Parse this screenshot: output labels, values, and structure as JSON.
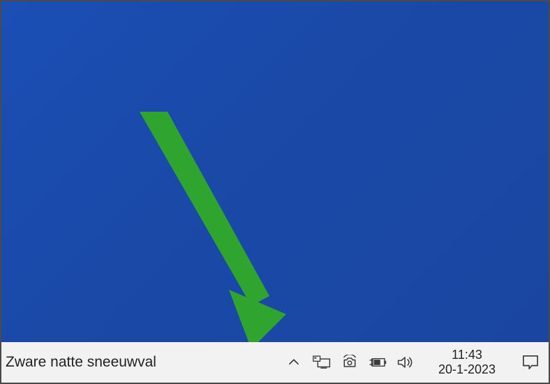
{
  "weather": {
    "text": "Zware natte sneeuwval"
  },
  "clock": {
    "time": "11:43",
    "date": "20-1-2023"
  },
  "colors": {
    "arrow": "#2fa52f"
  },
  "icons": {
    "chevron": "chevron-up-icon",
    "network": "network-monitor-icon",
    "camera": "camera-icon",
    "battery": "battery-charging-icon",
    "volume": "volume-icon",
    "action": "action-center-icon"
  }
}
